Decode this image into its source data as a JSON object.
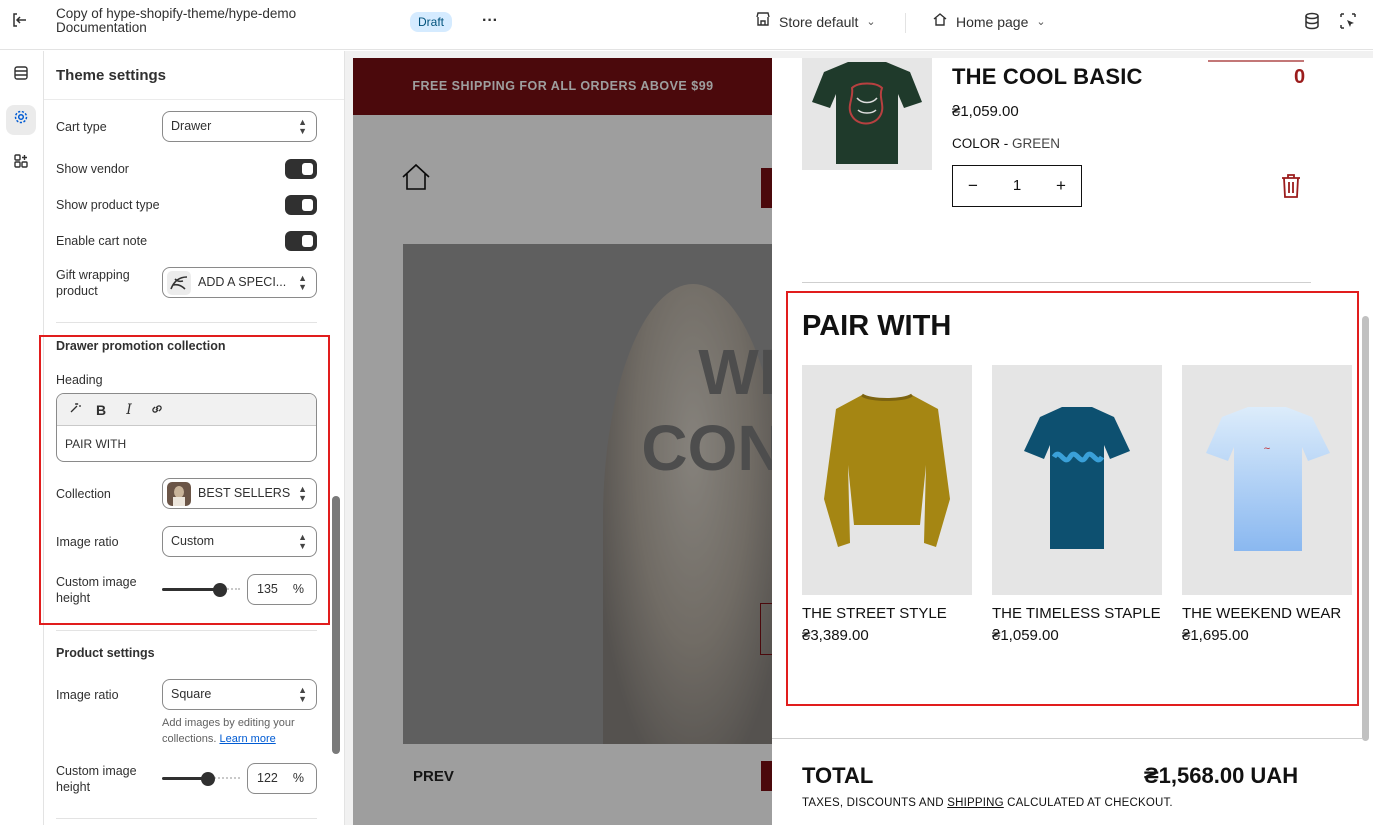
{
  "topbar": {
    "theme_title": "Copy of hype-shopify-theme/hype-demo Documentation",
    "status_badge": "Draft",
    "more_label": "···",
    "store_select": "Store default",
    "page_select": "Home page"
  },
  "panel": {
    "title": "Theme settings",
    "cart_type_label": "Cart type",
    "cart_type_value": "Drawer",
    "show_vendor_label": "Show vendor",
    "show_product_type_label": "Show product type",
    "enable_cart_note_label": "Enable cart note",
    "gift_wrapping_label": "Gift wrapping product",
    "gift_wrapping_value": "ADD A SPECI...",
    "drawer_promo": {
      "section_title": "Drawer promotion collection",
      "heading_label": "Heading",
      "heading_value": "PAIR WITH",
      "collection_label": "Collection",
      "collection_value": "BEST SELLERS",
      "image_ratio_label": "Image ratio",
      "image_ratio_value": "Custom",
      "custom_height_label": "Custom image height",
      "custom_height_value": "135",
      "custom_height_unit": "%"
    },
    "product_settings": {
      "section_title": "Product settings",
      "image_ratio_label": "Image ratio",
      "image_ratio_value": "Square",
      "help_text": "Add images by editing your collections.",
      "help_link": "Learn more",
      "custom_height_label": "Custom image height",
      "custom_height_value": "122",
      "custom_height_unit": "%"
    }
  },
  "preview": {
    "announcement": "FREE SHIPPING FOR ALL ORDERS ABOVE $99",
    "hero_text": "WEA CON EVI",
    "prev_label": "PREV"
  },
  "cart": {
    "item_name": "THE COOL BASIC",
    "item_old_price_fragment": "0",
    "item_price": "₴1,059.00",
    "item_color_label": "COLOR -",
    "item_color_value": "GREEN",
    "quantity": "1",
    "qty_minus": "−",
    "qty_plus": "+",
    "pair_heading": "PAIR WITH",
    "products": [
      {
        "name": "THE STREET STYLE",
        "price": "₴3,389.00"
      },
      {
        "name": "THE TIMELESS STAPLE",
        "price": "₴1,059.00"
      },
      {
        "name": "THE WEEKEND WEAR",
        "price": "₴1,695.00"
      }
    ],
    "total_label": "TOTAL",
    "total_value": "₴1,568.00 UAH",
    "note_before": "TAXES, DISCOUNTS AND ",
    "note_link": "SHIPPING",
    "note_after": " CALCULATED AT CHECKOUT."
  },
  "colors": {
    "accent_brand": "#7a0f14",
    "highlight_box": "#e11d1d",
    "badge_bg": "#d5ebff"
  }
}
